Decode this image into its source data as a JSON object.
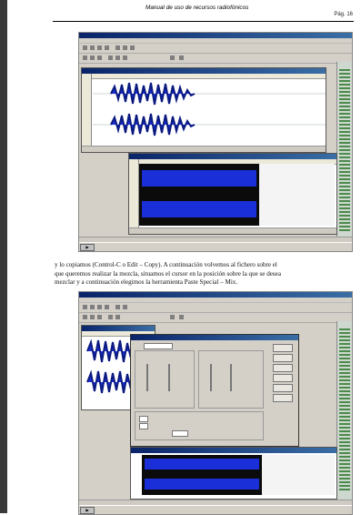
{
  "header": {
    "title": "Manual de uso de recursos radiofónicos",
    "page": "Pág. 16"
  },
  "paragraph": {
    "lines": [
      "y lo copiamos (Control-C o Edit – Copy). A continuación volvemos al fichero sobre el",
      "que queremos realizar la mezcla, situamos el cursor en la posición sobre la que se desea",
      "mezclar y a continuación elegimos la herramienta Paste Special – Mix."
    ]
  },
  "screenshots": [
    {
      "name": "screenshot-copy-selection",
      "description": "audio-editor-two-windows"
    },
    {
      "name": "screenshot-paste-special-dialog",
      "description": "audio-editor-mix-dialog"
    }
  ],
  "colors": {
    "waveform": "#1b2fd8",
    "titlebar": "#0a246a",
    "window_bg": "#d4d0c8"
  }
}
